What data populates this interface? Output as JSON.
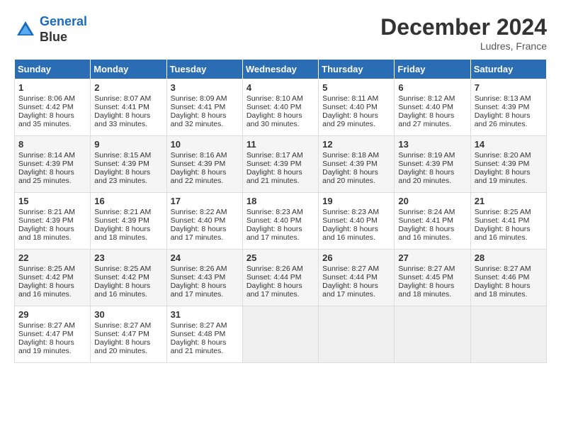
{
  "header": {
    "logo_line1": "General",
    "logo_line2": "Blue",
    "month": "December 2024",
    "location": "Ludres, France"
  },
  "days_of_week": [
    "Sunday",
    "Monday",
    "Tuesday",
    "Wednesday",
    "Thursday",
    "Friday",
    "Saturday"
  ],
  "weeks": [
    [
      {
        "day": "1",
        "sunrise": "Sunrise: 8:06 AM",
        "sunset": "Sunset: 4:42 PM",
        "daylight": "Daylight: 8 hours and 35 minutes."
      },
      {
        "day": "2",
        "sunrise": "Sunrise: 8:07 AM",
        "sunset": "Sunset: 4:41 PM",
        "daylight": "Daylight: 8 hours and 33 minutes."
      },
      {
        "day": "3",
        "sunrise": "Sunrise: 8:09 AM",
        "sunset": "Sunset: 4:41 PM",
        "daylight": "Daylight: 8 hours and 32 minutes."
      },
      {
        "day": "4",
        "sunrise": "Sunrise: 8:10 AM",
        "sunset": "Sunset: 4:40 PM",
        "daylight": "Daylight: 8 hours and 30 minutes."
      },
      {
        "day": "5",
        "sunrise": "Sunrise: 8:11 AM",
        "sunset": "Sunset: 4:40 PM",
        "daylight": "Daylight: 8 hours and 29 minutes."
      },
      {
        "day": "6",
        "sunrise": "Sunrise: 8:12 AM",
        "sunset": "Sunset: 4:40 PM",
        "daylight": "Daylight: 8 hours and 27 minutes."
      },
      {
        "day": "7",
        "sunrise": "Sunrise: 8:13 AM",
        "sunset": "Sunset: 4:39 PM",
        "daylight": "Daylight: 8 hours and 26 minutes."
      }
    ],
    [
      {
        "day": "8",
        "sunrise": "Sunrise: 8:14 AM",
        "sunset": "Sunset: 4:39 PM",
        "daylight": "Daylight: 8 hours and 25 minutes."
      },
      {
        "day": "9",
        "sunrise": "Sunrise: 8:15 AM",
        "sunset": "Sunset: 4:39 PM",
        "daylight": "Daylight: 8 hours and 23 minutes."
      },
      {
        "day": "10",
        "sunrise": "Sunrise: 8:16 AM",
        "sunset": "Sunset: 4:39 PM",
        "daylight": "Daylight: 8 hours and 22 minutes."
      },
      {
        "day": "11",
        "sunrise": "Sunrise: 8:17 AM",
        "sunset": "Sunset: 4:39 PM",
        "daylight": "Daylight: 8 hours and 21 minutes."
      },
      {
        "day": "12",
        "sunrise": "Sunrise: 8:18 AM",
        "sunset": "Sunset: 4:39 PM",
        "daylight": "Daylight: 8 hours and 20 minutes."
      },
      {
        "day": "13",
        "sunrise": "Sunrise: 8:19 AM",
        "sunset": "Sunset: 4:39 PM",
        "daylight": "Daylight: 8 hours and 20 minutes."
      },
      {
        "day": "14",
        "sunrise": "Sunrise: 8:20 AM",
        "sunset": "Sunset: 4:39 PM",
        "daylight": "Daylight: 8 hours and 19 minutes."
      }
    ],
    [
      {
        "day": "15",
        "sunrise": "Sunrise: 8:21 AM",
        "sunset": "Sunset: 4:39 PM",
        "daylight": "Daylight: 8 hours and 18 minutes."
      },
      {
        "day": "16",
        "sunrise": "Sunrise: 8:21 AM",
        "sunset": "Sunset: 4:39 PM",
        "daylight": "Daylight: 8 hours and 18 minutes."
      },
      {
        "day": "17",
        "sunrise": "Sunrise: 8:22 AM",
        "sunset": "Sunset: 4:40 PM",
        "daylight": "Daylight: 8 hours and 17 minutes."
      },
      {
        "day": "18",
        "sunrise": "Sunrise: 8:23 AM",
        "sunset": "Sunset: 4:40 PM",
        "daylight": "Daylight: 8 hours and 17 minutes."
      },
      {
        "day": "19",
        "sunrise": "Sunrise: 8:23 AM",
        "sunset": "Sunset: 4:40 PM",
        "daylight": "Daylight: 8 hours and 16 minutes."
      },
      {
        "day": "20",
        "sunrise": "Sunrise: 8:24 AM",
        "sunset": "Sunset: 4:41 PM",
        "daylight": "Daylight: 8 hours and 16 minutes."
      },
      {
        "day": "21",
        "sunrise": "Sunrise: 8:25 AM",
        "sunset": "Sunset: 4:41 PM",
        "daylight": "Daylight: 8 hours and 16 minutes."
      }
    ],
    [
      {
        "day": "22",
        "sunrise": "Sunrise: 8:25 AM",
        "sunset": "Sunset: 4:42 PM",
        "daylight": "Daylight: 8 hours and 16 minutes."
      },
      {
        "day": "23",
        "sunrise": "Sunrise: 8:25 AM",
        "sunset": "Sunset: 4:42 PM",
        "daylight": "Daylight: 8 hours and 16 minutes."
      },
      {
        "day": "24",
        "sunrise": "Sunrise: 8:26 AM",
        "sunset": "Sunset: 4:43 PM",
        "daylight": "Daylight: 8 hours and 17 minutes."
      },
      {
        "day": "25",
        "sunrise": "Sunrise: 8:26 AM",
        "sunset": "Sunset: 4:44 PM",
        "daylight": "Daylight: 8 hours and 17 minutes."
      },
      {
        "day": "26",
        "sunrise": "Sunrise: 8:27 AM",
        "sunset": "Sunset: 4:44 PM",
        "daylight": "Daylight: 8 hours and 17 minutes."
      },
      {
        "day": "27",
        "sunrise": "Sunrise: 8:27 AM",
        "sunset": "Sunset: 4:45 PM",
        "daylight": "Daylight: 8 hours and 18 minutes."
      },
      {
        "day": "28",
        "sunrise": "Sunrise: 8:27 AM",
        "sunset": "Sunset: 4:46 PM",
        "daylight": "Daylight: 8 hours and 18 minutes."
      }
    ],
    [
      {
        "day": "29",
        "sunrise": "Sunrise: 8:27 AM",
        "sunset": "Sunset: 4:47 PM",
        "daylight": "Daylight: 8 hours and 19 minutes."
      },
      {
        "day": "30",
        "sunrise": "Sunrise: 8:27 AM",
        "sunset": "Sunset: 4:47 PM",
        "daylight": "Daylight: 8 hours and 20 minutes."
      },
      {
        "day": "31",
        "sunrise": "Sunrise: 8:27 AM",
        "sunset": "Sunset: 4:48 PM",
        "daylight": "Daylight: 8 hours and 21 minutes."
      },
      null,
      null,
      null,
      null
    ]
  ]
}
